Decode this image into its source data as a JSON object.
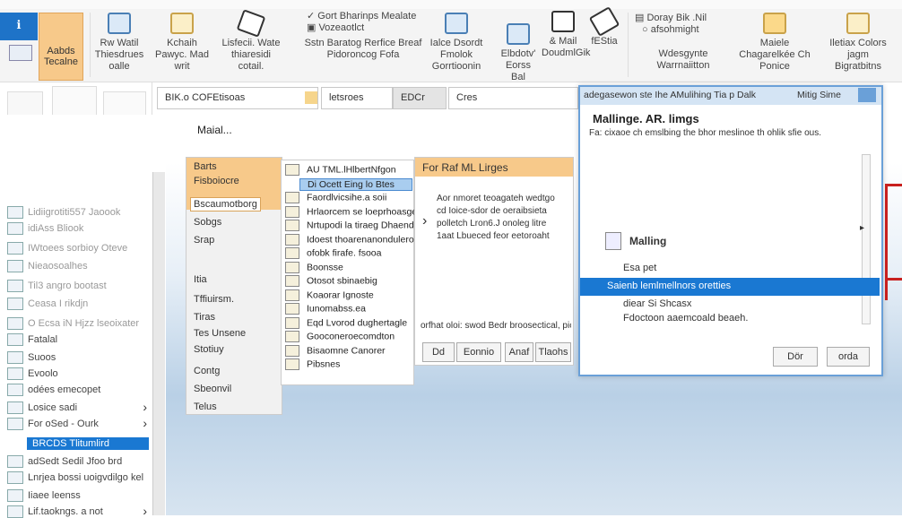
{
  "colors": {
    "accent": "#1e73c8",
    "highlight": "#f7c98a",
    "selection": "#1a78d2",
    "bracket": "#c8201e"
  },
  "ribbon": {
    "groups": [
      {
        "label": "Aabds Tecalne"
      },
      {
        "label": "Rw Watil Thiesdrues oalle"
      },
      {
        "label": "Kchaih Pawyc. Mad writ"
      },
      {
        "label": "Lisfecii. Wate thiaresidi cotail."
      },
      {
        "label": "Sstn Baratog Rerfice Breaf Pidoroncog Fofa"
      },
      {
        "label": "Ialce Dsordt Fmolok Gorrtioonin"
      },
      {
        "label": "Elbdotv' Eorss Bal"
      },
      {
        "label": "& Mail DoudmlGik"
      },
      {
        "label": "fEStia"
      },
      {
        "label": "Wdesgynte Warrnaiitton"
      },
      {
        "label": "Maiele Chagarelkée Ch Ponice"
      },
      {
        "label": "Iletiax Colors jagm Bigratbitns"
      }
    ],
    "small_items": [
      "Gort Bharinps Mealate",
      "Vozeaotlct",
      "Doray Bik .Nil",
      "afsohmight"
    ]
  },
  "toolbar": {
    "field1": "BIK.o COFEtisoas",
    "field2": "letsroes",
    "field3": "EDCr",
    "search": "Cres"
  },
  "sidebar": {
    "items": [
      {
        "label": "Lidiigrotiti557 Jaoook",
        "faded": true
      },
      {
        "label": "idiAss Bliook",
        "faded": true
      },
      {
        "label": "IWtoees sorbioy Oteve",
        "faded": true
      },
      {
        "label": "Nieaosoalhes",
        "faded": true
      },
      {
        "label": "Til3 angro bootast",
        "faded": true
      },
      {
        "label": "Ceasa I rikdjn",
        "faded": true
      },
      {
        "label": "O Ecsa iN Hjzz lseoixater",
        "faded": true
      },
      {
        "label": "Fatalal"
      },
      {
        "label": "Suoos"
      },
      {
        "label": "Evoolo"
      },
      {
        "label": "odées emecopet"
      },
      {
        "label": "Losice sadi"
      },
      {
        "label": "For oSed - Ourk"
      },
      {
        "label": "BRCDS Tlitumlird",
        "selected": true
      },
      {
        "label": "adSedt Sedil Jfoo brd"
      },
      {
        "label": "Lnrjea bossi uoigvdilgo kel"
      },
      {
        "label": "Iiaee leenss"
      },
      {
        "label": "Lif.taokngs. a not"
      }
    ]
  },
  "main": {
    "title": "Maial..."
  },
  "menu": {
    "items": [
      "Barts",
      "Fisboiocre",
      "Bscaumotborg",
      "Sobgs",
      "Srap",
      "Itia",
      "Tffiuirsm.",
      "Tiras",
      "Tes Unsene",
      "Stotiuy",
      "Contg",
      "Sbeonvil",
      "Telus"
    ]
  },
  "submenu": {
    "items": [
      "AU TML.lHlbertNfgon",
      "Di Ocett Eing lo Btes",
      "Faordlvicsihe.a soii",
      "Hrlaorcem se loeprhoasge.",
      "Nrtupodi la tiraeg Dhaend",
      "Idoest thoarenanonduleroe",
      "ofobk firafe. fsooa",
      "Boonsse",
      "Otosot sbinaebig",
      "Koaorar Ignoste",
      "Iunomabss.ea",
      "Eqd Lvorod dughertagle",
      "Gooconeroecomdton",
      "Bisaomne Canorer",
      "Pibsnes"
    ]
  },
  "right_panel": {
    "header": "For Raf ML Lirges",
    "lines": [
      "Aor nmoret teoagateh wedtgo",
      "cd Ioice-sdor de oeraibsieta",
      "polletch Lron6.J onoleg litre",
      "1aat Lbueced feor eetoroaht"
    ],
    "footer": "orfhat oloi: swod Bedr broosectical, pio",
    "buttons": [
      "Dd",
      "Eonnio",
      "Anaf",
      "Tlaohs"
    ]
  },
  "dialog": {
    "title": "adegasewon ste Ihe AMulihing Tia p Dalk",
    "title_right": "Mitig Sime",
    "heading": "Mallinge. AR. limgs",
    "description": "Fa: cixaoe ch emslbing the bhor meslinoe th ohlik sfie ous.",
    "section": "Malling",
    "list": [
      "Esa pet",
      "Saienb lemlmellnors oretties",
      "diear Si Shcasx",
      "Fdoctoon aaemcoald beaeh."
    ],
    "selected_index": 1,
    "buttons": {
      "ok": "Dör",
      "cancel": "orda"
    }
  }
}
